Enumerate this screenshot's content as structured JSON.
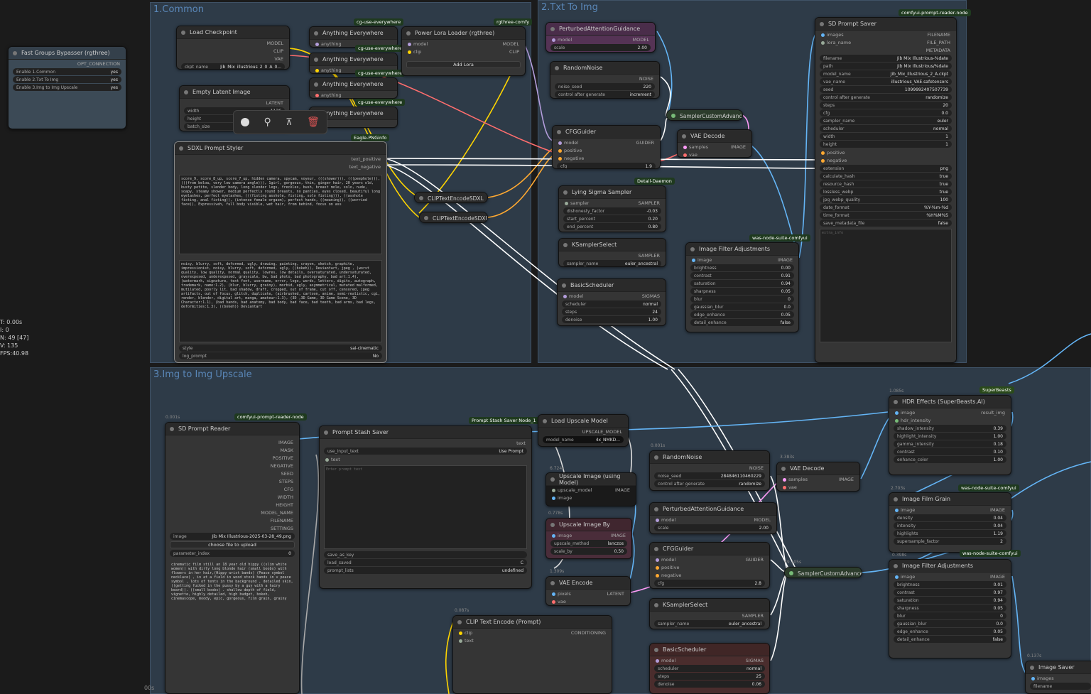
{
  "groups": {
    "common": "1.Common",
    "txt2img": "2.Txt To Img",
    "img2img": "3.Img to Img Upscale"
  },
  "bypasser": {
    "title": "Fast Groups Bypasser (rgthree)",
    "output": "OPT_CONNECTION",
    "rows": [
      {
        "label": "Enable 1.Common",
        "value": "yes"
      },
      {
        "label": "Enable 2.Txt To Img",
        "value": "yes"
      },
      {
        "label": "Enable 3.Img to Img Upscale",
        "value": "yes"
      }
    ]
  },
  "load_checkpoint": {
    "title": "Load Checkpoint",
    "outs": [
      "MODEL",
      "CLIP",
      "VAE"
    ],
    "ckpt_label": "ckpt_name",
    "ckpt_value": "Jib_Mix_illustrious_2_0_A_0..."
  },
  "anything": {
    "title": "Anything Everywhere",
    "in": "anything",
    "badge": "cg-use-everywhere"
  },
  "lora": {
    "title": "Power Lora Loader (rgthree)",
    "badge": "rgthree-comfy",
    "ins": [
      "model",
      "clip"
    ],
    "outs": [
      "MODEL",
      "CLIP"
    ],
    "button": "Add Lora"
  },
  "empty_latent": {
    "title": "Empty Latent Image",
    "out": "LATENT",
    "w_label": "width",
    "w_value": "1136",
    "h_label": "height",
    "b_label": "batch_size"
  },
  "sdxl_styler": {
    "title": "SDXL Prompt Styler",
    "badge": "Eagle-PNGinfo",
    "outs": [
      "text_positive",
      "text_negative"
    ],
    "positive_text": "score_9, score_8_up, score_7_up, hidden camera, spycam, voyeur, (((shower))), (((peephole))), (((from below, very low camera angle))), 1girl, gorgeous, thin, ginger hair, 20 years old, busty petite, slender body, long slender legs, freckles, bush, breast mole, solo, nude, soapy, steamy shower, medium perfectly round breasts, no panties, eyes closed, beautiful long eyelashes, perfect eyelashes, (((fisting asshole, fisting, solo fisting))), ((asshole fisting, anal fisting)), (intense female orgasm), perfect hands, ((moaning)), ((worried face)), Expressiveh, full body visible, wet hair, from behind, focus on ass",
    "negative_text": "noisy, blurry, soft, deformed, ugly, drawing, painting, crayon, sketch, graphite, impressionist, noisy, blurry, soft, deformed, ugly, ((bokeh)), Deviantart, jpeg , (worst quality, low quality, normal quality, lowres, low details, oversaturated, undersaturated, overexposed, underexposed, grayscale, bw, bad photo, bad photography, bad art:1.4), (watermark, signature, text font, username, error, logo, words, letters, digits, autograph, trademark, name:1.2), (blur, blurry, grainy), morbid, ugly, asymmetrical, mutated malformed, mutilated, poorly lit, bad shadow, draft, cropped, out of frame, cut off, censored, jpeg artifacts, out of focus, glitch, duplicate, (airbrushed, cartoon, anime, semi-realistic, cgi, render, blender, digital art, manga, amateur:1.3), (3D ,3D Game, 3D Game Scene, 3D Character:1.1), (bad hands, bad anatomy, bad body, bad face, bad teeth, bad arms, bad legs, deformities:1.3), ((bokeh)) Deviantart",
    "style_label": "style",
    "style_value": "sai-cinematic",
    "log_label": "log_prompt",
    "log_value": "No"
  },
  "clip_encode_a": "CLIPTextEncodeSDXL",
  "clip_encode_b": "CLIPTextEncodeSDXL",
  "pag": {
    "title": "PerturbedAttentionGuidance",
    "in": "model",
    "out": "MODEL",
    "scale_label": "scale",
    "scale_value": "2.00"
  },
  "random_noise": {
    "title": "RandomNoise",
    "out": "NOISE",
    "seed_label": "noise_seed",
    "seed_value": "220",
    "cag_label": "control after generate",
    "cag_value": "increment"
  },
  "cfg_guider": {
    "title": "CFGGuider",
    "ins": [
      "model",
      "positive",
      "negative"
    ],
    "out": "GUIDER",
    "cfg_label": "cfg",
    "cfg_value": "1.9"
  },
  "sampler_adv": "SamplerCustomAdvance",
  "vae_decode": {
    "title": "VAE Decode",
    "ins": [
      "samples",
      "vae"
    ],
    "out": "IMAGE"
  },
  "lying_sigma": {
    "title": "Lying Sigma Sampler",
    "badge": "Detail-Daemon",
    "in": "sampler",
    "out": "SAMPLER",
    "rows": [
      {
        "label": "dishonesty_factor",
        "value": "-0.03"
      },
      {
        "label": "start_percent",
        "value": "0.20"
      },
      {
        "label": "end_percent",
        "value": "0.80"
      }
    ]
  },
  "ksampler_select": {
    "title": "KSamplerSelect",
    "out": "SAMPLER",
    "label": "sampler_name",
    "value": "euler_ancestral"
  },
  "basic_scheduler": {
    "title": "BasicScheduler",
    "in": "model",
    "out": "SIGMAS",
    "rows": [
      {
        "label": "scheduler",
        "value": "normal"
      },
      {
        "label": "steps",
        "value": "24"
      },
      {
        "label": "denoise",
        "value": "1.00"
      }
    ]
  },
  "image_filter": {
    "title": "Image Filter Adjustments",
    "badge": "was-node-suite-comfyui",
    "in": "image",
    "out": "IMAGE",
    "rows": [
      {
        "label": "brightness",
        "value": "0.00"
      },
      {
        "label": "contrast",
        "value": "0.91"
      },
      {
        "label": "saturation",
        "value": "0.94"
      },
      {
        "label": "sharpness",
        "value": "0.05"
      },
      {
        "label": "blur",
        "value": "0"
      },
      {
        "label": "gaussian_blur",
        "value": "0.0"
      },
      {
        "label": "edge_enhance",
        "value": "0.05"
      },
      {
        "label": "detail_enhance",
        "value": "false"
      }
    ]
  },
  "prompt_saver": {
    "title": "SD Prompt Saver",
    "badge": "comfyui-prompt-reader-node",
    "ins": [
      "images",
      "lora_name"
    ],
    "outs": [
      "FILENAME",
      "FILE_PATH",
      "METADATA"
    ],
    "rows": [
      {
        "label": "filename",
        "value": "Jib Mix Illustrious-%date"
      },
      {
        "label": "path",
        "value": "Jib Mix Illustrious/%date"
      },
      {
        "label": "model_name",
        "value": "Jib_Mix_illustrious_2_A.ckpt"
      },
      {
        "label": "vae_name",
        "value": "illustrious_VAE.safetensors"
      },
      {
        "label": "seed",
        "value": "1099992407507739"
      },
      {
        "label": "control after generate",
        "value": "randomize"
      },
      {
        "label": "steps",
        "value": "20"
      },
      {
        "label": "cfg",
        "value": "0.0"
      },
      {
        "label": "sampler_name",
        "value": "euler"
      },
      {
        "label": "scheduler",
        "value": "normal"
      },
      {
        "label": "width",
        "value": "1"
      },
      {
        "label": "height",
        "value": "1"
      }
    ],
    "ins2": [
      "positive",
      "negative"
    ],
    "rows2": [
      {
        "label": "extension",
        "value": "png"
      },
      {
        "label": "calculate_hash",
        "value": "true"
      },
      {
        "label": "resource_hash",
        "value": "true"
      },
      {
        "label": "lossless_webp",
        "value": "true"
      },
      {
        "label": "jpg_webp_quality",
        "value": "100"
      },
      {
        "label": "date_format",
        "value": "%Y-%m-%d"
      },
      {
        "label": "time_format",
        "value": "%H%M%S"
      },
      {
        "label": "save_metadata_file",
        "value": "false"
      }
    ],
    "extra": "extra_info"
  },
  "stats": [
    "T: 0.00s",
    "I: 0",
    "N: 49 [47]",
    "V: 135",
    "FPS:40.98"
  ],
  "sd_reader": {
    "title": "SD Prompt Reader",
    "badge": "comfyui-prompt-reader-node",
    "time": "0.001s",
    "outs": [
      "IMAGE",
      "MASK",
      "POSITIVE",
      "NEGATIVE",
      "SEED",
      "STEPS",
      "CFG",
      "WIDTH",
      "HEIGHT",
      "MODEL_NAME",
      "FILENAME",
      "SETTINGS"
    ],
    "image_label": "image",
    "image_value": "Jib Mix Illustrious-2025-03-28_49.png",
    "upload": "choose file to upload",
    "pi_label": "parameter_index",
    "pi_value": "0",
    "text": "cinematic film still an 18 year old hippy ((slim white women)) with dirty long blonde hair (small boobs) with flowers in her hair,(Hippy wrist bands) (Peace symbol necklace) , in at a field in wood stock hands in v peace symbol , lots of tents in the background , detailed skin, ((getting fucked in the pussy by a guy with a hairy beard)). ((small boobs) . shallow depth of field, vignette, highly detailed, high budget, bokeh, cinemascope, moody, epic, gorgeous, film grain, grainy"
  },
  "stash": {
    "title": "Prompt Stash Saver",
    "badge": "Prompt Stash Saver Node_1",
    "out": "text",
    "use_label": "use_input_text",
    "use_value": "Use Prompt",
    "in": "text",
    "placeholder": "Enter prompt text",
    "save_as": "save_as_key",
    "load_label": "load_saved",
    "load_value": "C",
    "lists_label": "prompt_lists",
    "lists_value": "undefined"
  },
  "load_upscale": {
    "title": "Load Upscale Model",
    "out": "UPSCALE_MODEL",
    "label": "model_name",
    "value": "4x_NMKD..."
  },
  "upscale_using": {
    "title": "Upscale Image (using Model)",
    "time": "6.724s",
    "ins": [
      "upscale_model",
      "image"
    ],
    "out": "IMAGE"
  },
  "upscale_by": {
    "title": "Upscale Image By",
    "time": "0.778s",
    "in": "image",
    "out": "IMAGE",
    "rows": [
      {
        "label": "upscale_method",
        "value": "lanczos"
      },
      {
        "label": "scale_by",
        "value": "0.50"
      }
    ]
  },
  "vae_encode": {
    "title": "VAE Encode",
    "time": "1.309s",
    "ins": [
      "pixels",
      "vae"
    ],
    "out": "LATENT"
  },
  "clip_text": {
    "title": "CLIP Text Encode (Prompt)",
    "time": "0.087s",
    "ins": [
      "clip",
      "text"
    ],
    "out": "CONDITIONING"
  },
  "random_noise2": {
    "title": "RandomNoise",
    "time": "0.001s",
    "out": "NOISE",
    "seed_label": "noise_seed",
    "seed_value": "284846110460229",
    "cag_label": "control after generate",
    "cag_value": "randomize"
  },
  "pag2": {
    "title": "PerturbedAttentionGuidance",
    "in": "model",
    "out": "MODEL",
    "scale_label": "scale",
    "scale_value": "2.00"
  },
  "cfg2": {
    "title": "CFGGuider",
    "ins": [
      "model",
      "positive",
      "negative"
    ],
    "out": "GUIDER",
    "cfg_label": "cfg",
    "cfg_value": "2.8"
  },
  "ksampler2": {
    "title": "KSamplerSelect",
    "out": "SAMPLER",
    "label": "sampler_name",
    "value": "euler_ancestral"
  },
  "basic2": {
    "title": "BasicScheduler",
    "in": "model",
    "out": "SIGMAS",
    "rows": [
      {
        "label": "scheduler",
        "value": "normal"
      },
      {
        "label": "steps",
        "value": "25"
      },
      {
        "label": "denoise",
        "value": "0.06"
      }
    ]
  },
  "vae_decode2": {
    "title": "VAE Decode",
    "time": "3.383s",
    "ins": [
      "samples",
      "vae"
    ],
    "out": "IMAGE"
  },
  "sampler2": {
    "title": "SamplerCustomAdvance",
    "time": "89.105s"
  },
  "hdr": {
    "title": "HDR Effects (SuperBeasts.AI)",
    "badge": "SuperBeasts",
    "time": "1.085s",
    "ins": [
      "image",
      "hdr_intensity"
    ],
    "out": "result_img",
    "rows": [
      {
        "label": "shadow_intensity",
        "value": "0.39"
      },
      {
        "label": "highlight_intensity",
        "value": "1.00"
      },
      {
        "label": "gamma_intensity",
        "value": "0.18"
      },
      {
        "label": "contrast",
        "value": "0.10"
      },
      {
        "label": "enhance_color",
        "value": "1.00"
      }
    ]
  },
  "film_grain": {
    "title": "Image Film Grain",
    "badge": "was-node-suite-comfyui",
    "time": "2.703s",
    "in": "image",
    "out": "IMAGE",
    "rows": [
      {
        "label": "density",
        "value": "0.04"
      },
      {
        "label": "intensity",
        "value": "0.04"
      },
      {
        "label": "highlights",
        "value": "1.19"
      },
      {
        "label": "supersample_factor",
        "value": "2"
      }
    ]
  },
  "filter2": {
    "title": "Image Filter Adjustments",
    "badge": "was-node-suite-comfyui",
    "time": "0.398s",
    "in": "image",
    "out": "IMAGE",
    "rows": [
      {
        "label": "brightness",
        "value": "0.01"
      },
      {
        "label": "contrast",
        "value": "0.97"
      },
      {
        "label": "saturation",
        "value": "0.94"
      },
      {
        "label": "sharpness",
        "value": "0.05"
      },
      {
        "label": "blur",
        "value": "0"
      },
      {
        "label": "gaussian_blur",
        "value": "0.0"
      },
      {
        "label": "edge_enhance",
        "value": "0.05"
      },
      {
        "label": "detail_enhance",
        "value": "false"
      }
    ]
  },
  "image_saver": {
    "title": "Image Saver",
    "time": "0.137s",
    "in": "images",
    "field": "filename"
  },
  "bottom_time": "00s"
}
